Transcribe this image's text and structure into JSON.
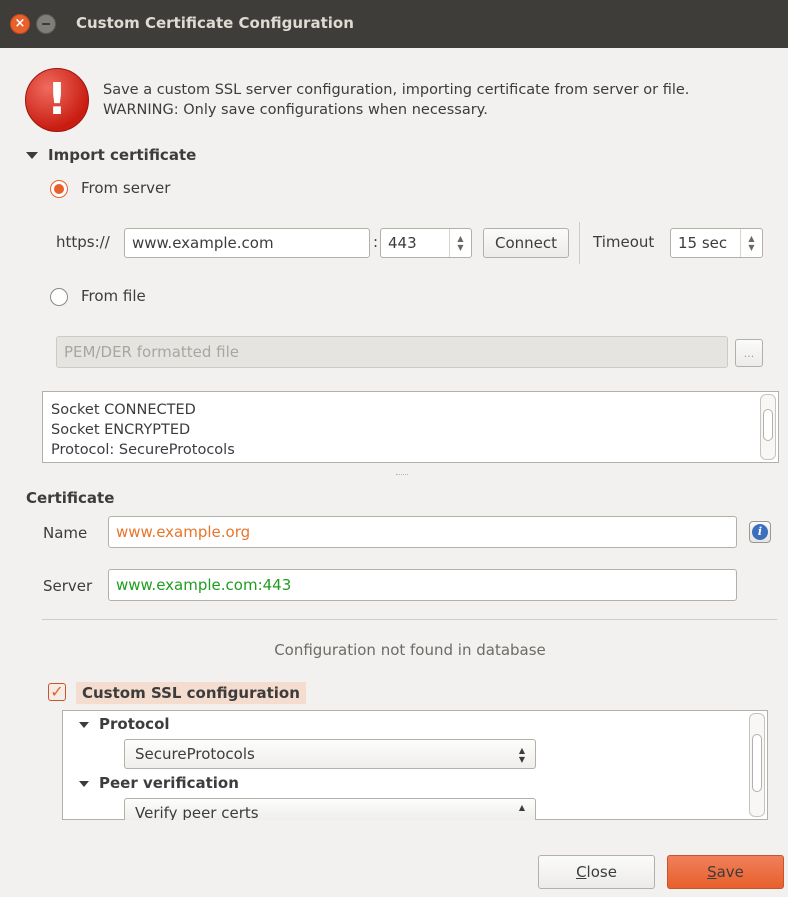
{
  "window": {
    "title": "Custom Certificate Configuration"
  },
  "warning": {
    "line1": "Save a custom SSL server configuration, importing certificate from server or file.",
    "line2": "WARNING: Only save configurations when necessary."
  },
  "import": {
    "header": "Import certificate",
    "from_server_label": "From server",
    "from_server_checked": true,
    "protocol_prefix": "https://",
    "host_value": "www.example.com",
    "port_separator": ":",
    "port_value": "443",
    "connect_label": "Connect",
    "timeout_label": "Timeout",
    "timeout_value": "15 sec",
    "from_file_label": "From file",
    "from_file_checked": false,
    "file_placeholder": "PEM/DER formatted file",
    "browse_label": "...",
    "log_lines": [
      "Socket CONNECTED",
      "Socket ENCRYPTED",
      "Protocol: SecureProtocols"
    ]
  },
  "certificate": {
    "header": "Certificate",
    "name_label": "Name",
    "name_value": "www.example.org",
    "name_color": "#e8752c",
    "server_label": "Server",
    "server_value": "www.example.com:443",
    "server_color": "#1e9e1e"
  },
  "status_text": "Configuration not found in database",
  "ssl": {
    "checkbox_label": "Custom SSL configuration",
    "checked": true,
    "protocol_header": "Protocol",
    "protocol_value": "SecureProtocols",
    "peer_header": "Peer verification",
    "peer_value": "Verify peer certs"
  },
  "buttons": {
    "close_label": "Close",
    "close_mnemonic": "C",
    "close_rest": "lose",
    "save_label": "Save",
    "save_mnemonic": "S",
    "save_rest": "ave"
  },
  "colors": {
    "accent": "#e8602c",
    "titlebar": "#3e3d39",
    "window_bg": "#f2f1f0"
  }
}
